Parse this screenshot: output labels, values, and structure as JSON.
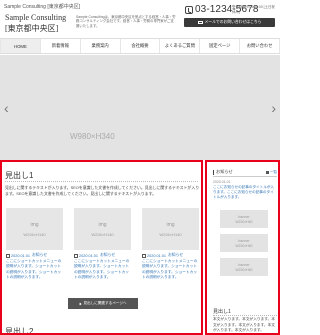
{
  "header": {
    "top_text": "Sample Consulting [東京都中央区]",
    "logo_line1": "Sample Consulting",
    "logo_line2": "[東京都中央区]",
    "description": "Sample Consultingは、東京都中央区を拠点とする経営・人事・労務コンサルティング会社です。経営・人事・労務の専門家がご支援いたします。",
    "phone": "03-1234-5678",
    "hours": "受付時間 9:00-18:00 [土日祝休み]",
    "mail_button": "メールでのお問い合わせはこちら"
  },
  "nav": {
    "items": [
      "HOME",
      "新着情報",
      "業務案内",
      "会社概要",
      "よくあるご質問",
      "固定ページ",
      "お問い合わせ"
    ]
  },
  "hero": {
    "placeholder": "W980×H340",
    "prev_arrow": "‹",
    "next_arrow": "›"
  },
  "main": {
    "heading1": "見出し1",
    "paragraph": "見出しに関するテキストが入ります。SEOを意識した文書を作成してください。見出しに関するテキストが入ります。SEOを意識した文書を作成してください。見出しに関するテキストが入ります。",
    "cards": [
      {
        "img_label": "img",
        "img_size": "W226×H140",
        "date": "2020.01.01",
        "category": "お知らせ",
        "text": "ここにショートカットメニューの説明が入ります。ショートカットの説明が入ります。ショートカットの説明が入ります。"
      },
      {
        "img_label": "img",
        "img_size": "W226×H140",
        "date": "2020.01.01",
        "category": "お知らせ",
        "text": "ここにショートカットメニューの説明が入ります。ショートカットの説明が入ります。ショートカットの説明が入ります。"
      },
      {
        "img_label": "img",
        "img_size": "W226×H140",
        "date": "2020.01.01",
        "category": "お知らせ",
        "text": "ここにショートカットメニューの説明が入ります。ショートカットの説明が入ります。ショートカットの説明が入ります。"
      }
    ],
    "more_button": "見出しに関連するページへ",
    "heading2": "見出し2"
  },
  "sidebar": {
    "title": "お知らせ",
    "list_link": "一覧",
    "date": "2020.01.01",
    "news": "ここにお知らせの記事のタイトルが入ります。ここにお知らせの記事のタイトルが入ります。",
    "banners": [
      {
        "label": "banner",
        "size": "W230×H60"
      },
      {
        "label": "banner",
        "size": "W230×H60"
      },
      {
        "label": "banner",
        "size": "W230×H60"
      }
    ],
    "heading": "見出し1",
    "paragraph": "本文が入ります。本文が入ります。本文が入ります。本文が入ります。本文が入ります。本文が入ります。"
  },
  "colors": {
    "highlight_border": "#e8001c",
    "link": "#2a6fb3",
    "dark_button": "#3a3a3a"
  }
}
